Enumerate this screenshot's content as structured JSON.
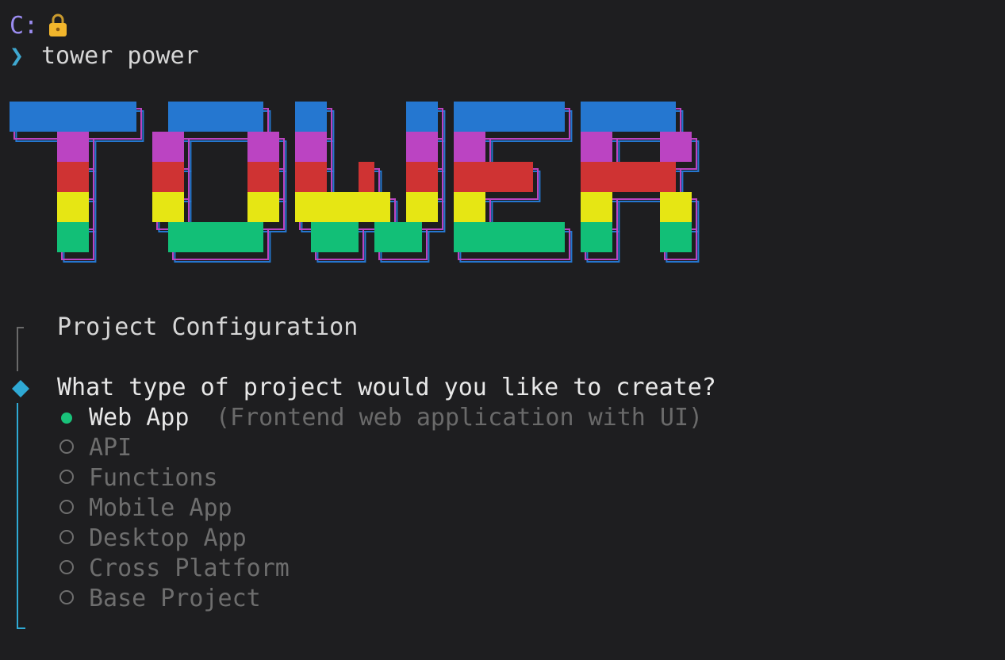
{
  "prompt": {
    "path": "C:",
    "chevron": "❯",
    "command": "tower power"
  },
  "banner": {
    "word": "TOWER"
  },
  "config": {
    "title": "Project Configuration",
    "question": "What type of project would you like to create?",
    "options": [
      {
        "label": "Web App",
        "hint": "(Frontend web application with UI)",
        "selected": true
      },
      {
        "label": "API",
        "selected": false
      },
      {
        "label": "Functions",
        "selected": false
      },
      {
        "label": "Mobile App",
        "selected": false
      },
      {
        "label": "Desktop App",
        "selected": false
      },
      {
        "label": "Cross Platform",
        "selected": false
      },
      {
        "label": "Base Project",
        "selected": false
      }
    ]
  },
  "colors": {
    "background": "#1e1e20",
    "blue": "#2577d0",
    "magenta": "#bb44c2",
    "red": "#cf3333",
    "yellow": "#e6e614",
    "green": "#12bf77",
    "accent": "#2fa9d4"
  },
  "icons": {
    "lock": "lock-icon",
    "diamond": "diamond-icon",
    "radio": "radio-icon"
  }
}
